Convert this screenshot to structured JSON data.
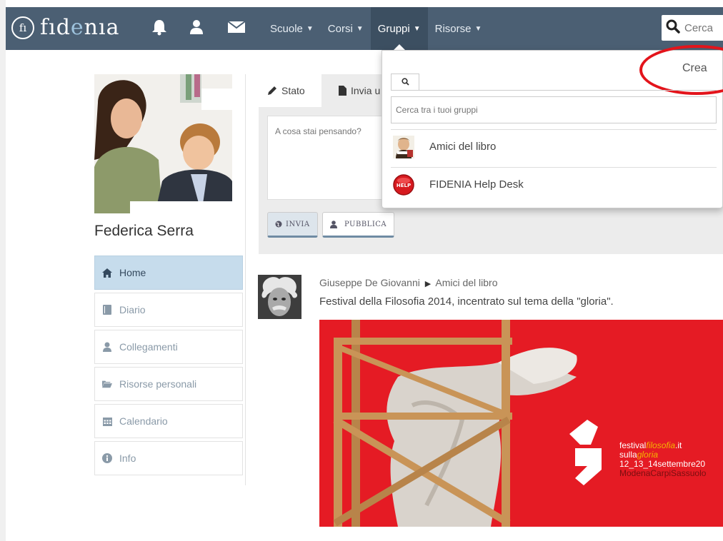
{
  "navbar": {
    "logo_mark": "fı",
    "logo_text_a": "fıd",
    "logo_text_b": "e",
    "logo_text_c": "nıa",
    "icons": [
      "bell-icon",
      "user-icon",
      "envelope-icon"
    ],
    "menu": [
      {
        "label": "Scuole"
      },
      {
        "label": "Corsi"
      },
      {
        "label": "Gruppi",
        "active": true
      },
      {
        "label": "Risorse"
      }
    ],
    "search_placeholder": "Cerca",
    "bg_color": "#4b5f73"
  },
  "profile": {
    "name": "Federica Serra"
  },
  "sidebar": {
    "items": [
      {
        "label": "Home",
        "icon": "home-icon",
        "active": true
      },
      {
        "label": "Diario",
        "icon": "book-icon"
      },
      {
        "label": "Collegamenti",
        "icon": "user-icon"
      },
      {
        "label": "Risorse personali",
        "icon": "folder-open-icon"
      },
      {
        "label": "Calendario",
        "icon": "calendar-icon"
      },
      {
        "label": "Info",
        "icon": "info-icon"
      }
    ]
  },
  "composer": {
    "tabs": [
      {
        "label": "Stato",
        "icon": "pencil-icon",
        "active": true
      },
      {
        "label": "Invia u",
        "icon": "file-icon"
      }
    ],
    "placeholder": "A cosa stai pensando?",
    "buttons": [
      {
        "label": "INVIA",
        "icon": "globe-icon"
      },
      {
        "label": "PUBBLICA",
        "icon": "user-icon"
      }
    ]
  },
  "groups_dropdown": {
    "create_label": "Crea",
    "search_placeholder": "Cerca tra i tuoi gruppi",
    "groups": [
      {
        "name": "Amici del libro",
        "icon": "shakespeare-avatar"
      },
      {
        "name": "FIDENIA Help Desk",
        "icon": "help-button-icon"
      }
    ],
    "highlight_color": "#e3141b"
  },
  "post": {
    "author": "Giuseppe De Giovanni",
    "arrow": "▶",
    "group": "Amici del libro",
    "text": "Festival della Filosofia 2014, incentrato sul tema della \"gloria\".",
    "image": {
      "bg_color": "#e51b24",
      "line1a": "festival",
      "line1b": "filosofia",
      "line1c": ".it",
      "line2a": "sulla",
      "line2b": "gloria",
      "line3": "12_13_14settembre20",
      "line4": "ModenaCarpiSassuolo"
    }
  }
}
